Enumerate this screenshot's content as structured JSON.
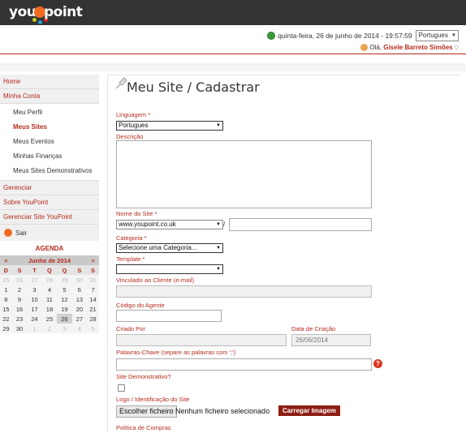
{
  "logo": {
    "part1": "you",
    "part2": "point"
  },
  "header": {
    "datetime": "quinta-feira, 26 de junho de 2014 - 19:57:59",
    "language": "Portugues",
    "greeting": "Olá,",
    "user_name": "Gisele Barreto Simões"
  },
  "sidebar": {
    "home": "Home",
    "minha_conta": "Minha Conta",
    "sub": [
      "Meu Perfil",
      "Meus Sites",
      "Meus Eventos",
      "Minhas Finanças",
      "Meus Sites Demonstrativos"
    ],
    "gerenciar": "Gerenciar",
    "sobre": "Sobre YouPoint",
    "gerenciar_site": "Gerenciar Site YouPoint",
    "sair": "Sair"
  },
  "agenda": {
    "title": "AGENDA",
    "prev": "<",
    "next": ">",
    "month": "Junho de 2014",
    "dow": [
      "D",
      "S",
      "T",
      "Q",
      "Q",
      "S",
      "S"
    ],
    "weeks": [
      [
        "25",
        "26",
        "27",
        "28",
        "29",
        "30",
        "31"
      ],
      [
        "1",
        "2",
        "3",
        "4",
        "5",
        "6",
        "7"
      ],
      [
        "8",
        "9",
        "10",
        "11",
        "12",
        "13",
        "14"
      ],
      [
        "15",
        "16",
        "17",
        "18",
        "19",
        "20",
        "21"
      ],
      [
        "22",
        "23",
        "24",
        "25",
        "26",
        "27",
        "28"
      ],
      [
        "29",
        "30",
        "1",
        "2",
        "3",
        "4",
        "5"
      ]
    ]
  },
  "form": {
    "page_title": "Meu Site / Cadastrar",
    "linguagem_label": "Linguagem *",
    "linguagem_value": "Portugues",
    "descricao_label": "Descrição",
    "nome_label": "Nome do Site *",
    "domain_value": "www.youpoint.co.uk",
    "slash": "/",
    "categoria_label": "Categoria *",
    "categoria_value": "Selecione uma Categoria...",
    "template_label": "Template *",
    "vinculado_label": "Vinculado ao Cliente (e-mail)",
    "codigo_label": "Código do Agente",
    "criado_label": "Criado Por",
    "data_label": "Data de Criação",
    "data_value": "26/06/2014",
    "palavras_label": "Palavras-Chave (separe as palavras com ';')",
    "help": "?",
    "demo_label": "Site Demonstrativo?",
    "logo_label": "Logo / Identificação do Site",
    "file_button": "Escolher ficheiro",
    "file_none": "Nenhum ficheiro selecionado",
    "upload_button": "Carregar Imagem",
    "politica_label": "Política de Compras"
  }
}
